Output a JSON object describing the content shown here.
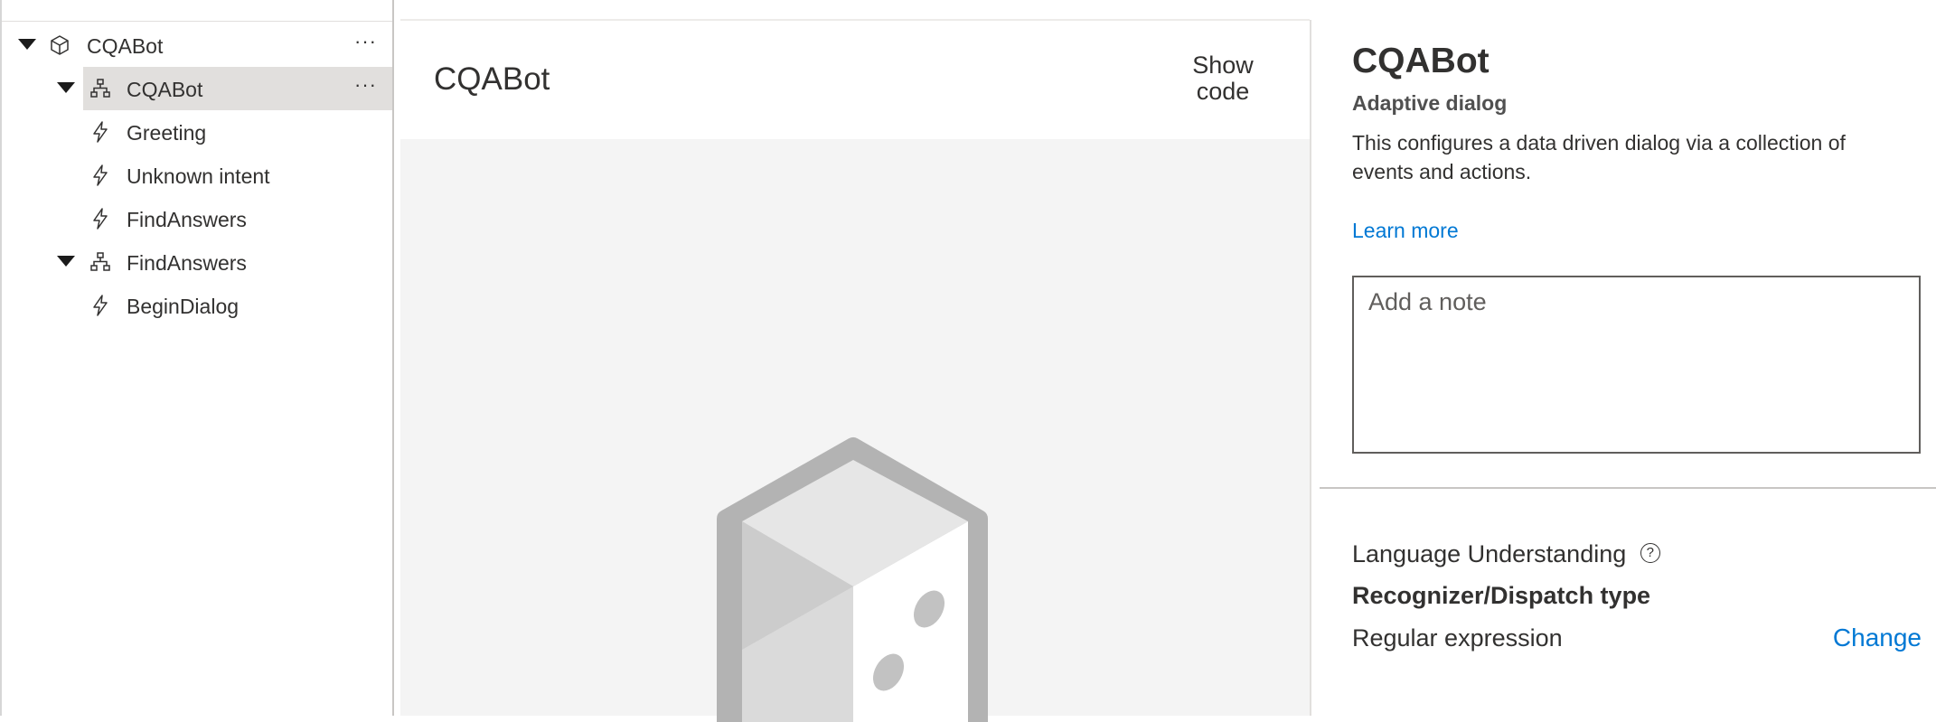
{
  "tree": {
    "items": [
      {
        "label": "CQABot",
        "icon": "box-icon",
        "level": 0,
        "expanded": true,
        "selected": false,
        "has_more": true
      },
      {
        "label": "CQABot",
        "icon": "dialog-icon",
        "level": 1,
        "expanded": true,
        "selected": true,
        "has_more": true
      },
      {
        "label": "Greeting",
        "icon": "lightning-icon",
        "level": 2
      },
      {
        "label": "Unknown intent",
        "icon": "lightning-icon",
        "level": 2
      },
      {
        "label": "FindAnswers",
        "icon": "lightning-icon",
        "level": 2
      },
      {
        "label": "FindAnswers",
        "icon": "dialog-icon",
        "level": 1,
        "expanded": true
      },
      {
        "label": "BeginDialog",
        "icon": "lightning-icon",
        "level": 2
      }
    ],
    "more_label": "···"
  },
  "canvas": {
    "title": "CQABot",
    "show_code": "Show code"
  },
  "properties": {
    "title": "CQABot",
    "subtitle": "Adaptive dialog",
    "description": "This configures a data driven dialog via a collection of events and actions.",
    "learn_more": "Learn more",
    "note_placeholder": "Add a note",
    "language_understanding": "Language Understanding",
    "help_glyph": "?",
    "recognizer_type_label": "Recognizer/Dispatch type",
    "recognizer_type_value": "Regular expression",
    "change_label": "Change"
  },
  "colors": {
    "accent": "#0078d4",
    "selected_bg": "#e1dfdd",
    "canvas_bg": "#f4f4f4"
  }
}
